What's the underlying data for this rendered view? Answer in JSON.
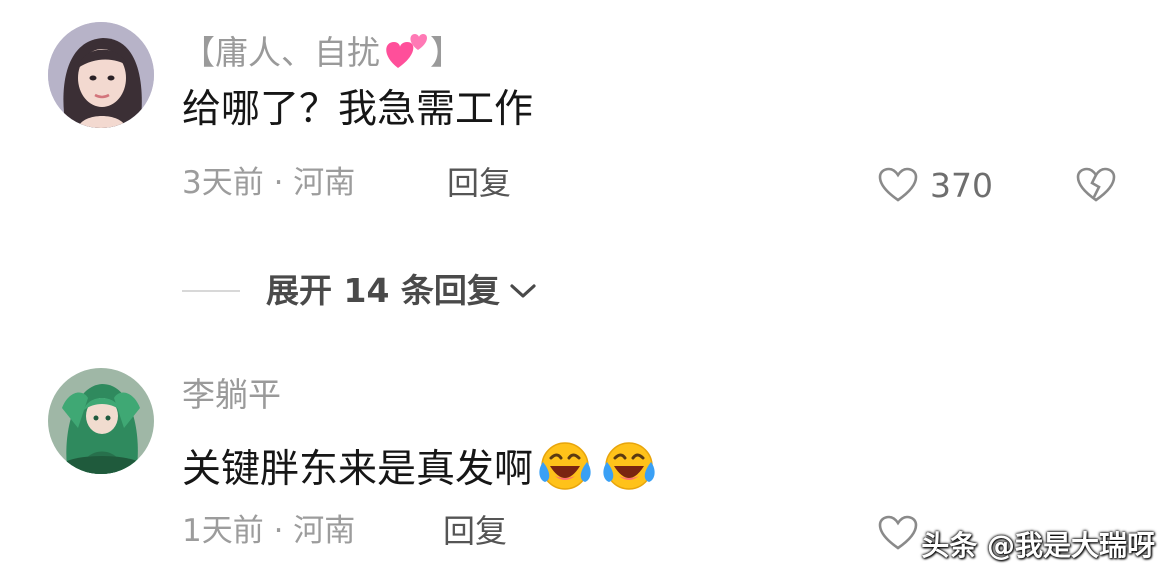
{
  "comments": [
    {
      "username": "【庸人、自扰",
      "username_suffix": "】",
      "text": "给哪了？我急需工作",
      "time": "3天前 · 河南",
      "reply_label": "回复",
      "likes": "370",
      "avatar_icon": "woman-avatar"
    },
    {
      "username": "李躺平",
      "text": "关键胖东来是真发啊",
      "time": "1天前 · 河南",
      "reply_label": "回复",
      "likes": "",
      "avatar_icon": "anime-figure-avatar"
    }
  ],
  "expand_replies": {
    "label": "展开 14 条回复"
  },
  "watermark": "头条 @我是大瑞呀",
  "colors": {
    "heart_emoji": "#ff4f9a",
    "laugh_emoji": "#ffc21a",
    "tears": "#3aa0f5"
  }
}
